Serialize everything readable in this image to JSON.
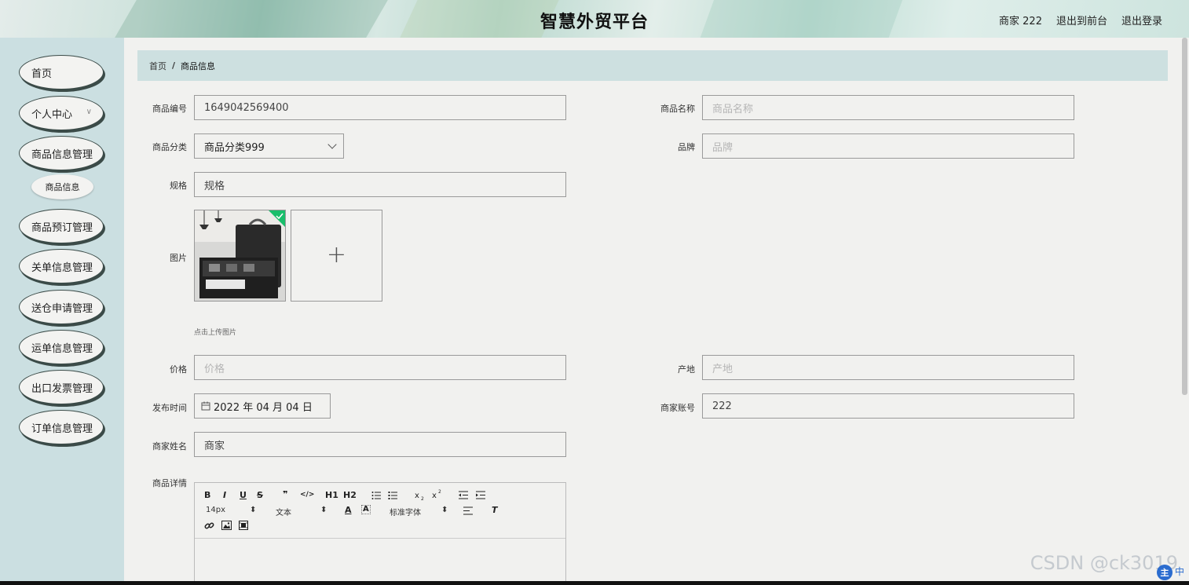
{
  "header": {
    "title": "智慧外贸平台",
    "user": "商家 222",
    "to_front": "退出到前台",
    "logout": "退出登录"
  },
  "sidebar": {
    "items": [
      {
        "label": "首页"
      },
      {
        "label": "个人中心"
      },
      {
        "label": "商品信息管理"
      },
      {
        "label": "商品信息"
      },
      {
        "label": "商品预订管理"
      },
      {
        "label": "关单信息管理"
      },
      {
        "label": "送仓申请管理"
      },
      {
        "label": "运单信息管理"
      },
      {
        "label": "出口发票管理"
      },
      {
        "label": "订单信息管理"
      }
    ],
    "chevron": "∨"
  },
  "breadcrumb": {
    "home": "首页",
    "separator": "/",
    "current": "商品信息"
  },
  "form": {
    "code": {
      "label": "商品编号",
      "value": "1649042569400"
    },
    "name": {
      "label": "商品名称",
      "placeholder": "商品名称"
    },
    "category": {
      "label": "商品分类",
      "value": "商品分类999"
    },
    "brand": {
      "label": "品牌",
      "placeholder": "品牌"
    },
    "spec": {
      "label": "规格",
      "value": "规格"
    },
    "image": {
      "label": "图片",
      "hint": "点击上传图片"
    },
    "price": {
      "label": "价格",
      "placeholder": "价格"
    },
    "origin": {
      "label": "产地",
      "placeholder": "产地"
    },
    "publish": {
      "label": "发布时间",
      "value": "2022 年 04 月 04 日"
    },
    "merchant_account": {
      "label": "商家账号",
      "value": "222"
    },
    "merchant_name": {
      "label": "商家姓名",
      "value": "商家"
    },
    "detail": {
      "label": "商品详情"
    }
  },
  "editor": {
    "font_size": "14px",
    "text_type": "文本",
    "font_family": "标准字体",
    "buttons": [
      "B",
      "I",
      "U",
      "S",
      "❞",
      "</>",
      "H1",
      "H2"
    ]
  },
  "watermark": "CSDN @ck3019",
  "ime": {
    "badge": "主",
    "mode": "中"
  }
}
